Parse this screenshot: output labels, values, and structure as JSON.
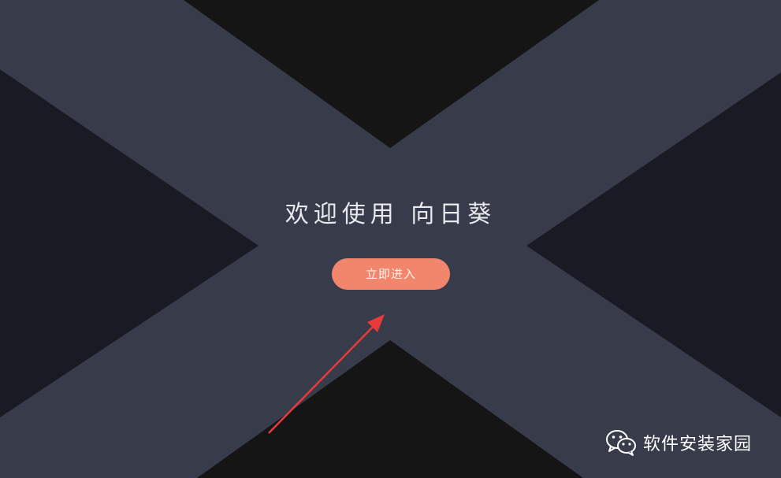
{
  "welcome": {
    "title": "欢迎使用 向日葵",
    "enter_button": "立即进入"
  },
  "watermark": {
    "text": "软件安装家园",
    "icon": "wechat-icon"
  },
  "colors": {
    "background_dark": "#151515",
    "side_dark": "#191a24",
    "x_band": "#383b4a",
    "button": "#f2866c",
    "arrow": "#e83a3a"
  }
}
